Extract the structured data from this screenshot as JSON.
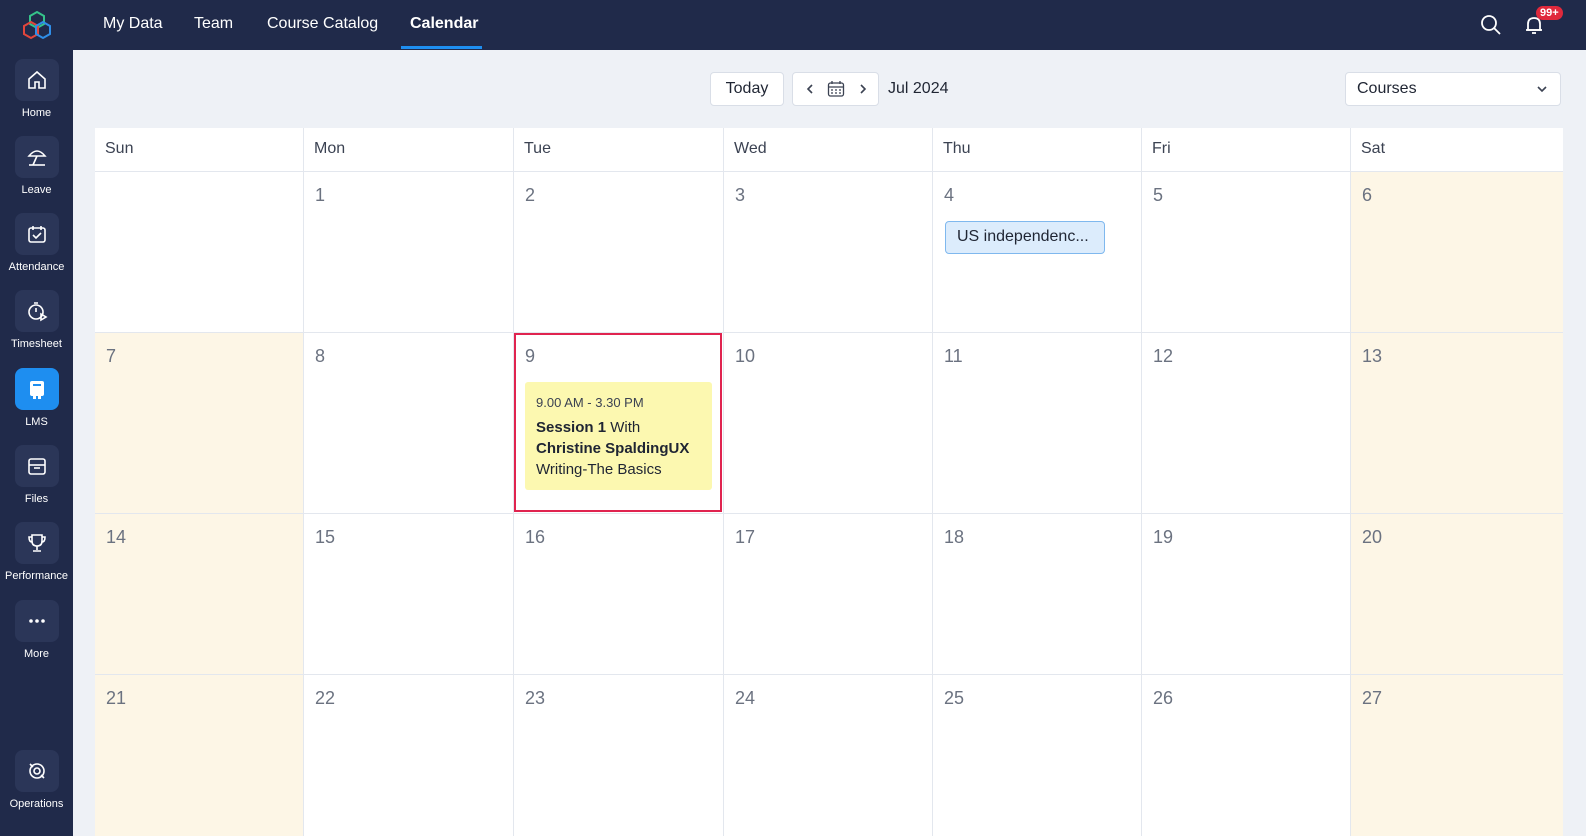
{
  "sidebar": {
    "items": [
      {
        "label": "Home",
        "icon": "home-icon"
      },
      {
        "label": "Leave",
        "icon": "beach-umbrella-icon"
      },
      {
        "label": "Attendance",
        "icon": "calendar-check-icon"
      },
      {
        "label": "Timesheet",
        "icon": "stopwatch-icon"
      },
      {
        "label": "LMS",
        "icon": "book-icon",
        "active": true
      },
      {
        "label": "Files",
        "icon": "folder-icon"
      },
      {
        "label": "Performance",
        "icon": "trophy-icon"
      },
      {
        "label": "More",
        "icon": "more-dots-icon"
      },
      {
        "label": "Operations",
        "icon": "operations-icon"
      }
    ]
  },
  "topnav": {
    "tabs": [
      {
        "label": "My Data"
      },
      {
        "label": "Team"
      },
      {
        "label": "Course Catalog"
      },
      {
        "label": "Calendar",
        "active": true
      }
    ],
    "notification_count": "99+"
  },
  "toolbar": {
    "today_label": "Today",
    "month_label": "Jul 2024",
    "courses_label": "Courses"
  },
  "calendar": {
    "weekdays": [
      "Sun",
      "Mon",
      "Tue",
      "Wed",
      "Thu",
      "Fri",
      "Sat"
    ],
    "weeks": [
      [
        "",
        "1",
        "2",
        "3",
        "4",
        "5",
        "6"
      ],
      [
        "7",
        "8",
        "9",
        "10",
        "11",
        "12",
        "13"
      ],
      [
        "14",
        "15",
        "16",
        "17",
        "18",
        "19",
        "20"
      ],
      [
        "21",
        "22",
        "23",
        "24",
        "25",
        "26",
        "27"
      ]
    ],
    "holiday": {
      "label": "US independenc...",
      "day": "4"
    },
    "event": {
      "day": "9",
      "time": "9.00 AM - 3.30 PM",
      "title_bold": "Session 1",
      "title_rest": " With",
      "title_line2": "Christine SpaldingUX",
      "title_line3": "Writing-The Basics"
    }
  },
  "colors": {
    "nav_bg": "#202a4a",
    "accent": "#1e8ef0",
    "weekend_bg": "#fdf6e6",
    "event_bg": "#fcf8b0",
    "highlight_border": "#e0244f",
    "holiday_bg": "#dcecfc"
  }
}
